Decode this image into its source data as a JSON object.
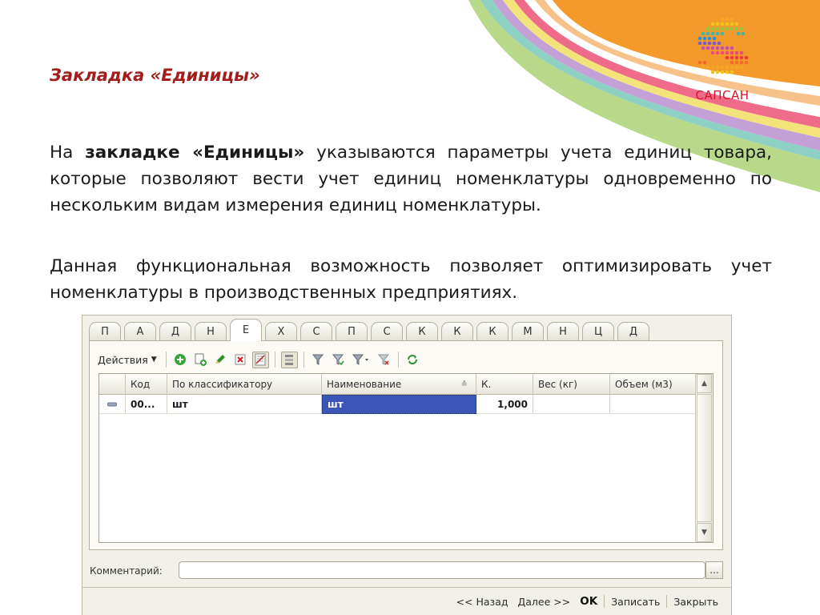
{
  "slide": {
    "title": "Закладка «Единицы»",
    "para1_lead": "На ",
    "para1_bold": "закладке «Единицы»",
    "para1_rest": " указываются параметры учета единиц товара, которые позволяют вести учет единиц номенклатуры одновременно по нескольким видам измерения единиц номенклатуры.",
    "para2": "Данная функциональная возможность позволяет оптимизировать учет номенклатуры в производственных предприятиях."
  },
  "logo": {
    "text": "САПСАН"
  },
  "colors": {
    "orange": "#f39a2b",
    "logo_red": "#d8152a",
    "title": "#a31d1d",
    "selection": "#3b56b8"
  },
  "window": {
    "tabs": [
      {
        "label": "П"
      },
      {
        "label": "А"
      },
      {
        "label": "Д"
      },
      {
        "label": "Н"
      },
      {
        "label": "Е",
        "active": true
      },
      {
        "label": "Х"
      },
      {
        "label": "С"
      },
      {
        "label": "П"
      },
      {
        "label": "С"
      },
      {
        "label": "К"
      },
      {
        "label": "К"
      },
      {
        "label": "К"
      },
      {
        "label": "М"
      },
      {
        "label": "Н"
      },
      {
        "label": "Ц"
      },
      {
        "label": "Д"
      }
    ],
    "toolbar": {
      "actions_label": "Действия",
      "icons": [
        "add-icon",
        "copy-icon",
        "edit-pencil-icon",
        "delete-icon",
        "checklist-icon",
        "hierarchy-icon",
        "filter-set-icon",
        "filter-icon",
        "filter-dropdown-icon",
        "filter-clear-icon",
        "refresh-icon"
      ]
    },
    "grid": {
      "columns": [
        "Код",
        "По классификатору",
        "Наименование",
        "К.",
        "Вес (кг)",
        "Объем (м3)"
      ],
      "rows": [
        {
          "code": "00...",
          "classifier": "шт",
          "name": "шт",
          "k": "1,000",
          "weight": "",
          "volume": ""
        }
      ]
    },
    "comment": {
      "label": "Комментарий:",
      "value": "",
      "more": "..."
    },
    "footer": {
      "back": "<< Назад",
      "next": "Далее >>",
      "ok": "OK",
      "save": "Записать",
      "close": "Закрыть"
    }
  }
}
